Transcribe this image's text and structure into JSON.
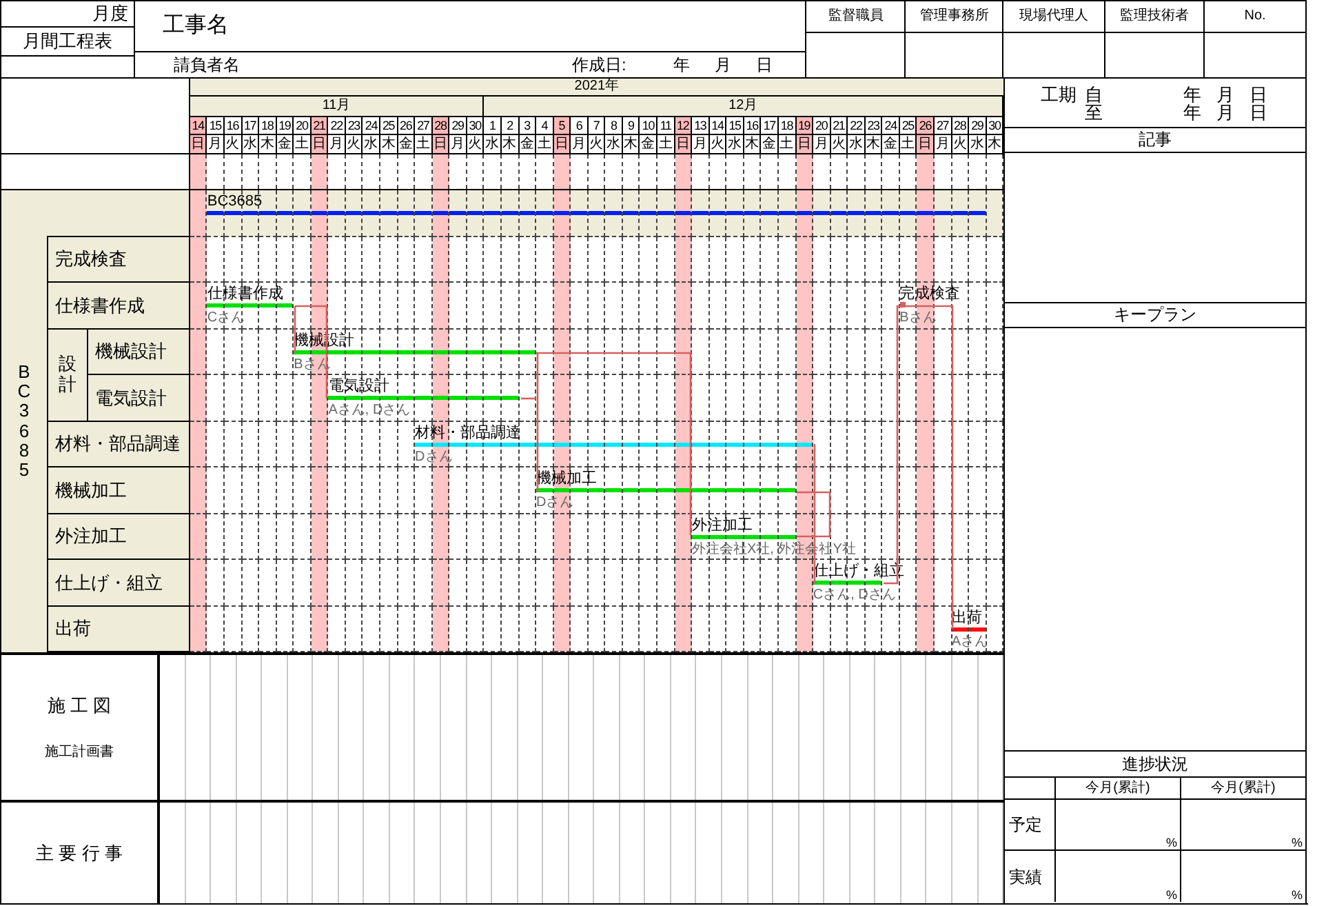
{
  "header": {
    "month_label": "月度",
    "title_label": "月間工程表",
    "project_label": "工事名",
    "contractor_label": "請負者名",
    "created_label": "作成日:",
    "date_units": [
      "年",
      "月",
      "日"
    ],
    "approvals": [
      {
        "label": "監督職員"
      },
      {
        "label": "管理事務所"
      },
      {
        "label": "現場代理人"
      },
      {
        "label": "監理技術者"
      },
      {
        "label": "No."
      }
    ]
  },
  "calendar": {
    "year": "2021年",
    "months": [
      {
        "label": "11月",
        "days": [
          {
            "day": "14",
            "weekday": "日",
            "holiday": true
          },
          {
            "day": "15",
            "weekday": "月",
            "holiday": false
          },
          {
            "day": "16",
            "weekday": "火",
            "holiday": false
          },
          {
            "day": "17",
            "weekday": "水",
            "holiday": false
          },
          {
            "day": "18",
            "weekday": "木",
            "holiday": false
          },
          {
            "day": "19",
            "weekday": "金",
            "holiday": false
          },
          {
            "day": "20",
            "weekday": "土",
            "holiday": false
          },
          {
            "day": "21",
            "weekday": "日",
            "holiday": true
          },
          {
            "day": "22",
            "weekday": "月",
            "holiday": false
          },
          {
            "day": "23",
            "weekday": "火",
            "holiday": false
          },
          {
            "day": "24",
            "weekday": "水",
            "holiday": false
          },
          {
            "day": "25",
            "weekday": "木",
            "holiday": false
          },
          {
            "day": "26",
            "weekday": "金",
            "holiday": false
          },
          {
            "day": "27",
            "weekday": "土",
            "holiday": false
          },
          {
            "day": "28",
            "weekday": "日",
            "holiday": true
          },
          {
            "day": "29",
            "weekday": "月",
            "holiday": false
          },
          {
            "day": "30",
            "weekday": "火",
            "holiday": false
          }
        ]
      },
      {
        "label": "12月",
        "days": [
          {
            "day": "1",
            "weekday": "水",
            "holiday": false
          },
          {
            "day": "2",
            "weekday": "木",
            "holiday": false
          },
          {
            "day": "3",
            "weekday": "金",
            "holiday": false
          },
          {
            "day": "4",
            "weekday": "土",
            "holiday": false
          },
          {
            "day": "5",
            "weekday": "日",
            "holiday": true
          },
          {
            "day": "6",
            "weekday": "月",
            "holiday": false
          },
          {
            "day": "7",
            "weekday": "火",
            "holiday": false
          },
          {
            "day": "8",
            "weekday": "水",
            "holiday": false
          },
          {
            "day": "9",
            "weekday": "木",
            "holiday": false
          },
          {
            "day": "10",
            "weekday": "金",
            "holiday": false
          },
          {
            "day": "11",
            "weekday": "土",
            "holiday": false
          },
          {
            "day": "12",
            "weekday": "日",
            "holiday": true
          },
          {
            "day": "13",
            "weekday": "月",
            "holiday": false
          },
          {
            "day": "14",
            "weekday": "火",
            "holiday": false
          },
          {
            "day": "15",
            "weekday": "水",
            "holiday": false
          },
          {
            "day": "16",
            "weekday": "木",
            "holiday": false
          },
          {
            "day": "17",
            "weekday": "金",
            "holiday": false
          },
          {
            "day": "18",
            "weekday": "土",
            "holiday": false
          },
          {
            "day": "19",
            "weekday": "日",
            "holiday": true
          },
          {
            "day": "20",
            "weekday": "月",
            "holiday": false
          },
          {
            "day": "21",
            "weekday": "火",
            "holiday": false
          },
          {
            "day": "22",
            "weekday": "水",
            "holiday": false
          },
          {
            "day": "23",
            "weekday": "木",
            "holiday": false
          },
          {
            "day": "24",
            "weekday": "金",
            "holiday": false
          },
          {
            "day": "25",
            "weekday": "土",
            "holiday": false
          },
          {
            "day": "26",
            "weekday": "日",
            "holiday": true
          },
          {
            "day": "27",
            "weekday": "月",
            "holiday": false
          },
          {
            "day": "28",
            "weekday": "火",
            "holiday": false
          },
          {
            "day": "29",
            "weekday": "水",
            "holiday": false
          },
          {
            "day": "30",
            "weekday": "木",
            "holiday": false
          }
        ]
      }
    ]
  },
  "project": {
    "name": "BC3685",
    "bar": {
      "label": "BC3685",
      "color": "#0022ee",
      "kind": "dashed",
      "covers": [
        false,
        true,
        true,
        true,
        true,
        true,
        true,
        true,
        true,
        true,
        true,
        true,
        true,
        true,
        true,
        true,
        true,
        true,
        true,
        true,
        true,
        true,
        true,
        true,
        true,
        true,
        true,
        true,
        true,
        true,
        true,
        true,
        true,
        true,
        true,
        true,
        true,
        true,
        true,
        true,
        true,
        true,
        true,
        true,
        true,
        true,
        false
      ]
    },
    "rows": [
      {
        "label": "完成検査",
        "bars": []
      },
      {
        "label": "仕様書作成",
        "bars": [
          {
            "label": "仕様書作成",
            "assignee": "Cさん",
            "color": "#00e000",
            "kind": "solid",
            "covers": [
              false,
              true,
              true,
              true,
              true,
              true,
              false,
              false,
              false,
              false,
              false,
              false,
              false,
              false,
              false,
              false,
              false,
              false,
              false,
              false,
              false,
              false,
              false,
              false,
              false,
              false,
              false,
              false,
              false,
              false,
              false,
              false,
              false,
              false,
              false,
              false,
              false,
              false,
              false,
              false,
              false,
              false,
              false,
              false,
              false,
              false,
              false
            ]
          },
          {
            "label": "完成検査",
            "assignee": "Bさん",
            "kind": "milestone",
            "covers": [
              false,
              false,
              false,
              false,
              false,
              false,
              false,
              false,
              false,
              false,
              false,
              false,
              false,
              false,
              false,
              false,
              false,
              false,
              false,
              false,
              false,
              false,
              false,
              false,
              false,
              false,
              false,
              false,
              false,
              false,
              false,
              false,
              false,
              false,
              false,
              false,
              false,
              false,
              false,
              false,
              false,
              true,
              false,
              false,
              false,
              false,
              false
            ]
          }
        ]
      },
      {
        "label": "設計",
        "children": [
          {
            "label": "機械設計",
            "bars": [
              {
                "label": "機械設計",
                "assignee": "Bさん",
                "color": "#00e000",
                "kind": "solid",
                "covers": [
                  false,
                  false,
                  false,
                  false,
                  false,
                  false,
                  true,
                  true,
                  true,
                  true,
                  true,
                  true,
                  true,
                  true,
                  true,
                  true,
                  true,
                  true,
                  true,
                  true,
                  false,
                  false,
                  false,
                  false,
                  false,
                  false,
                  false,
                  false,
                  false,
                  false,
                  false,
                  false,
                  false,
                  false,
                  false,
                  false,
                  false,
                  false,
                  false,
                  false,
                  false,
                  false,
                  false,
                  false,
                  false,
                  false,
                  false
                ]
              }
            ]
          },
          {
            "label": "電気設計",
            "bars": [
              {
                "label": "電気設計",
                "assignee": "Aさん, Dさん",
                "color": "#00e000",
                "kind": "solid",
                "covers": [
                  false,
                  false,
                  false,
                  false,
                  false,
                  false,
                  false,
                  false,
                  true,
                  true,
                  true,
                  true,
                  true,
                  true,
                  true,
                  true,
                  true,
                  true,
                  true,
                  false,
                  false,
                  false,
                  false,
                  false,
                  false,
                  false,
                  false,
                  false,
                  false,
                  false,
                  false,
                  false,
                  false,
                  false,
                  false,
                  false,
                  false,
                  false,
                  false,
                  false,
                  false,
                  false,
                  false,
                  false,
                  false,
                  false,
                  false
                ]
              }
            ]
          }
        ]
      },
      {
        "label": "材料・部品調達",
        "bars": [
          {
            "label": "材料・部品調達",
            "assignee": "Dさん",
            "color": "#00e8ff",
            "kind": "solid",
            "covers": [
              false,
              false,
              false,
              false,
              false,
              false,
              false,
              false,
              false,
              false,
              false,
              false,
              false,
              true,
              true,
              true,
              true,
              true,
              true,
              true,
              true,
              true,
              true,
              true,
              true,
              true,
              true,
              true,
              true,
              true,
              true,
              true,
              true,
              true,
              true,
              true,
              false,
              false,
              false,
              false,
              false,
              false,
              false,
              false,
              false,
              false,
              false
            ]
          }
        ]
      },
      {
        "label": "機械加工",
        "bars": [
          {
            "label": "機械加工",
            "assignee": "Dさん",
            "color": "#00e000",
            "kind": "solid",
            "covers": [
              false,
              false,
              false,
              false,
              false,
              false,
              false,
              false,
              false,
              false,
              false,
              false,
              false,
              false,
              false,
              false,
              false,
              false,
              false,
              false,
              true,
              true,
              true,
              true,
              true,
              true,
              true,
              true,
              true,
              true,
              true,
              true,
              true,
              true,
              true,
              false,
              false,
              false,
              false,
              false,
              false,
              false,
              false,
              false,
              false,
              false,
              false
            ]
          }
        ]
      },
      {
        "label": "外注加工",
        "bars": [
          {
            "label": "外注加工",
            "assignee": "外注会社X社, 外注会社Y社",
            "color": "#00e000",
            "kind": "solid",
            "covers": [
              false,
              false,
              false,
              false,
              false,
              false,
              false,
              false,
              false,
              false,
              false,
              false,
              false,
              false,
              false,
              false,
              false,
              false,
              false,
              false,
              false,
              false,
              false,
              false,
              false,
              false,
              false,
              false,
              false,
              true,
              true,
              true,
              true,
              true,
              true,
              false,
              false,
              false,
              false,
              false,
              false,
              false,
              false,
              false,
              false,
              false,
              false
            ]
          }
        ]
      },
      {
        "label": "仕上げ・組立",
        "bars": [
          {
            "label": "仕上げ・組立",
            "assignee": "Cさん, Dさん",
            "color": "#00e000",
            "kind": "solid",
            "covers": [
              false,
              false,
              false,
              false,
              false,
              false,
              false,
              false,
              false,
              false,
              false,
              false,
              false,
              false,
              false,
              false,
              false,
              false,
              false,
              false,
              false,
              false,
              false,
              false,
              false,
              false,
              false,
              false,
              false,
              false,
              false,
              false,
              false,
              false,
              false,
              false,
              true,
              true,
              true,
              true,
              false,
              false,
              false,
              false,
              false,
              false,
              false
            ]
          }
        ]
      },
      {
        "label": "出荷",
        "bars": [
          {
            "label": "出荷",
            "assignee": "Aさん",
            "color": "#ff1010",
            "kind": "solid",
            "covers": [
              false,
              false,
              false,
              false,
              false,
              false,
              false,
              false,
              false,
              false,
              false,
              false,
              false,
              false,
              false,
              false,
              false,
              false,
              false,
              false,
              false,
              false,
              false,
              false,
              false,
              false,
              false,
              false,
              false,
              false,
              false,
              false,
              false,
              false,
              false,
              false,
              false,
              false,
              false,
              false,
              false,
              false,
              false,
              false,
              true,
              true,
              false
            ]
          }
        ]
      }
    ]
  },
  "bottom_sections": [
    {
      "title": "施 工 図",
      "subtitle": "施工計画書"
    },
    {
      "title": "主 要 行 事"
    }
  ],
  "side": {
    "period": {
      "label": "工期",
      "lines": [
        {
          "mark": "自",
          "units": [
            "年",
            "月",
            "日"
          ]
        },
        {
          "mark": "至",
          "units": [
            "年",
            "月",
            "日"
          ]
        }
      ]
    },
    "notes_label": "記事",
    "keyplan_label": "キープラン",
    "progress": {
      "title": "進捗状況",
      "columns": [
        "今月(累計)",
        "今月(累計)"
      ],
      "rows": [
        {
          "label": "予定",
          "values": [
            "%",
            "%"
          ]
        },
        {
          "label": "実績",
          "values": [
            "%",
            "%"
          ]
        }
      ]
    }
  }
}
